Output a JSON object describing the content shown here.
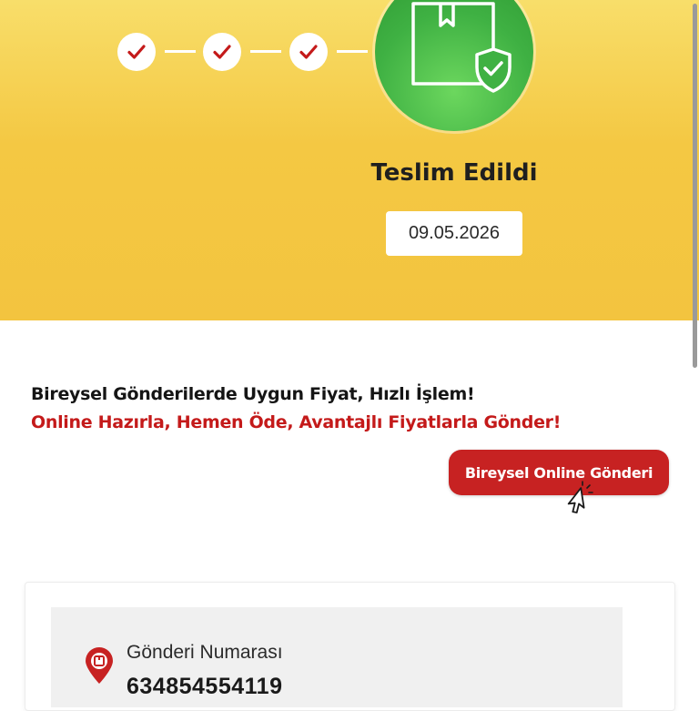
{
  "progress": {
    "completed_steps": 3,
    "steps": [
      {
        "icon": "checkmark-icon"
      },
      {
        "icon": "checkmark-icon"
      },
      {
        "icon": "checkmark-icon"
      }
    ],
    "current_icon": "package-shield-icon"
  },
  "status": {
    "title": "Teslim Edildi",
    "date": "09.05.2026"
  },
  "promo": {
    "line1": "Bireysel Gönderilerde Uygun Fiyat, Hızlı İşlem!",
    "line2": "Online Hazırla, Hemen Öde, Avantajlı Fiyatlarla Gönder!",
    "button_label": "Bireysel Online Gönderi",
    "button_icon": "click-cursor-icon"
  },
  "shipment": {
    "icon": "location-pin-icon",
    "label": "Gönderi Numarası",
    "number": "634854554119"
  },
  "colors": {
    "hero_yellow": "#f4c843",
    "success_green": "#3fb143",
    "brand_red": "#c72222",
    "check_red": "#c41a1a"
  }
}
